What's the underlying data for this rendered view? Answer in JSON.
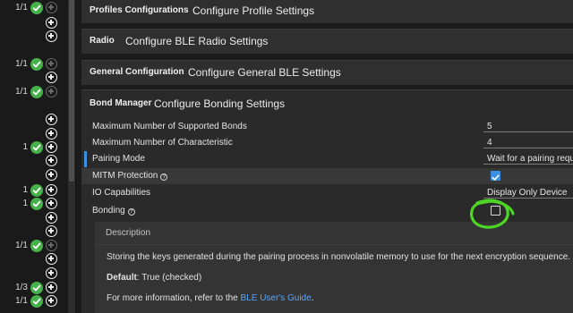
{
  "tree": {
    "rows": [
      {
        "count": "1/1",
        "check": true,
        "plus": "dim"
      },
      {
        "count": "",
        "check": false,
        "plus": "on"
      },
      {
        "count": "",
        "check": false,
        "plus": "on"
      },
      {
        "count": "1/1",
        "check": true,
        "plus": "dim"
      },
      {
        "count": "",
        "check": false,
        "plus": "on"
      },
      {
        "count": "1/1",
        "check": true,
        "plus": "dim"
      },
      {
        "count": "",
        "check": false,
        "plus": "on"
      },
      {
        "count": "",
        "check": false,
        "plus": "on"
      },
      {
        "count": "1",
        "check": true,
        "plus": "on"
      },
      {
        "count": "",
        "check": false,
        "plus": "on"
      },
      {
        "count": "",
        "check": false,
        "plus": "on"
      },
      {
        "count": "1",
        "check": true,
        "plus": "on"
      },
      {
        "count": "1",
        "check": true,
        "plus": "on"
      },
      {
        "count": "",
        "check": false,
        "plus": "on"
      },
      {
        "count": "",
        "check": false,
        "plus": "on"
      },
      {
        "count": "1/1",
        "check": true,
        "plus": "dim"
      },
      {
        "count": "",
        "check": false,
        "plus": "on"
      },
      {
        "count": "",
        "check": false,
        "plus": "on"
      },
      {
        "count": "1/3",
        "check": true,
        "plus": "on"
      },
      {
        "count": "1/1",
        "check": true,
        "plus": "on"
      }
    ]
  },
  "sections": {
    "profiles": {
      "label": "Profiles Configurations",
      "title": "Configure Profile Settings"
    },
    "radio": {
      "label": "Radio",
      "title": "Configure BLE Radio Settings"
    },
    "general": {
      "label": "General Configuration",
      "title": "Configure General BLE Settings"
    },
    "bond": {
      "label": "Bond Manager",
      "title": "Configure Bonding Settings"
    }
  },
  "bond_props": {
    "max_bonds": {
      "label": "Maximum Number of Supported Bonds",
      "value": "5"
    },
    "max_char": {
      "label": "Maximum Number of Characteristic",
      "value": "4"
    },
    "pairing_mode": {
      "label": "Pairing Mode",
      "value": "Wait for a pairing reque"
    },
    "mitm": {
      "label": "MITM Protection",
      "help": "?",
      "checked": true
    },
    "io_cap": {
      "label": "IO Capabilities",
      "value": "Display Only Device"
    },
    "bonding": {
      "label": "Bonding",
      "help": "?",
      "checked": false
    }
  },
  "description": {
    "header": "Description",
    "body": "Storing the keys generated during the pairing process in nonvolatile memory to use for the next encryption sequence.",
    "default_label": "Default",
    "default_value": ": True (checked)",
    "more_prefix": "For more information, refer to the ",
    "more_link": "BLE User's Guide",
    "more_suffix": "."
  },
  "colors": {
    "accent": "#3b8ee0",
    "check_green": "#46b04a",
    "annotation": "#4cd626",
    "link": "#58a6ff"
  }
}
